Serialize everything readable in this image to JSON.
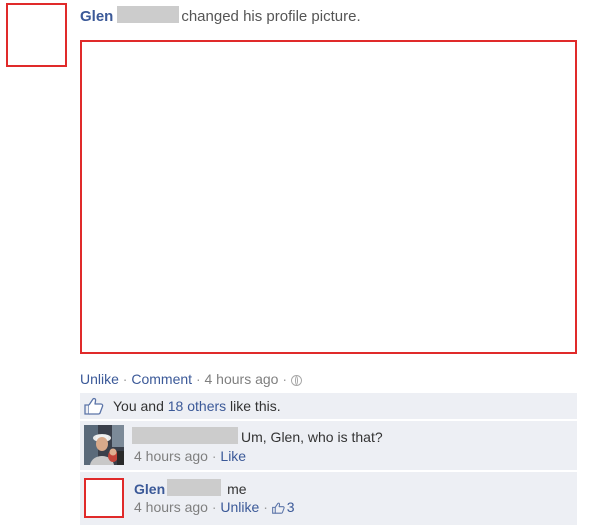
{
  "post": {
    "author_name": "Glen",
    "action_text": "changed his profile picture.",
    "actions": {
      "unlike": "Unlike",
      "comment": "Comment",
      "timestamp": "4 hours ago",
      "separator": "·",
      "privacy_icon": "globe-icon"
    }
  },
  "likes": {
    "prefix": "You and",
    "others_link": "18 others",
    "suffix": "like this.",
    "icon": "thumbs-up-icon"
  },
  "comments": [
    {
      "text": "Um, Glen, who is that?",
      "timestamp": "4 hours ago",
      "like_label": "Like"
    },
    {
      "author_name": "Glen",
      "text": "me",
      "timestamp": "4 hours ago",
      "unlike_label": "Unlike",
      "like_count": "3",
      "like_icon": "thumbs-up-icon"
    }
  ],
  "colors": {
    "link": "#3b5998",
    "meta": "#7f7f7f",
    "comment_bg": "#edeff4",
    "redaction": "#cccccc",
    "image_placeholder_border": "#e02a2a"
  }
}
